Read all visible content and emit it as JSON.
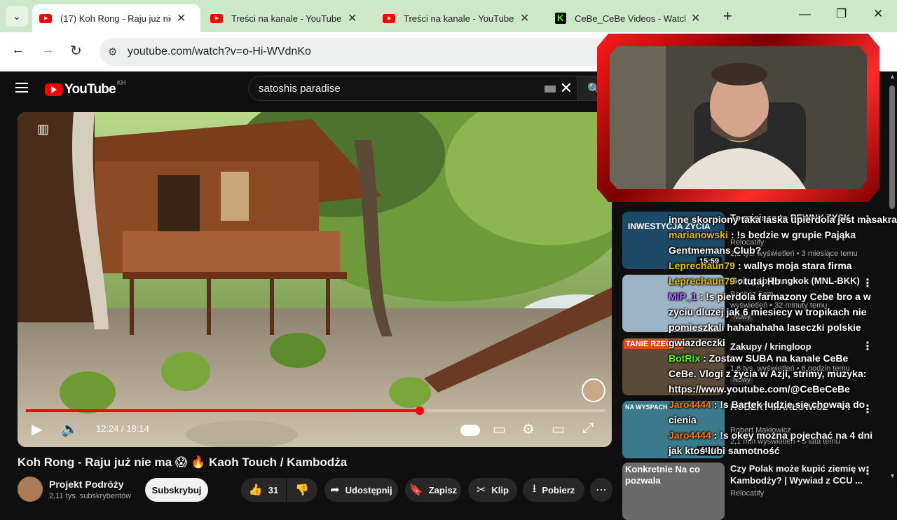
{
  "browser": {
    "tabs": [
      {
        "title": "(17) Koh Rong - Raju już nie ma",
        "icon": "youtube-icon",
        "active": true
      },
      {
        "title": "Treści na kanale - YouTube Studio",
        "icon": "youtube-icon",
        "active": false
      },
      {
        "title": "Treści na kanale - YouTube Studio",
        "icon": "youtube-icon",
        "active": false
      },
      {
        "title": "CeBe_CeBe Videos - Watch CeBe",
        "icon": "kick-icon",
        "active": false
      }
    ],
    "url": "youtube.com/watch?v=o-Hi-WVdnKo"
  },
  "youtube": {
    "logo_text": "YouTube",
    "country_code": "KH",
    "search_query": "satoshis paradise",
    "player": {
      "time_current": "12:24",
      "time_total": "18:14",
      "progress_fraction": 0.68
    },
    "video": {
      "title": "Koh Rong - Raju już nie ma 😱 🔥 Kaoh Touch / Kambodża",
      "channel": "Projekt Podróży",
      "subscribers": "2,11 tys. subskrybentów",
      "subscribe_label": "Subskrybuj",
      "likes": "31",
      "share_label": "Udostępnij",
      "save_label": "Zapisz",
      "clip_label": "Klip",
      "download_label": "Pobierz"
    },
    "recommendations": [
      {
        "title": "To miejsce to PEWNY ZYSK",
        "channel": "Relocatify",
        "meta": "2,2 tys. wyświetleń • 3 miesiące temu",
        "duration": "15:59",
        "thumb_text": "INWESTYCJA ŻYCIA"
      },
      {
        "title": "Going to Bangkok (MNL-BKK)",
        "channel": "Benitez Fam",
        "meta": "wyświetleń • 32 minuty temu",
        "badge": "Nowy",
        "duration": ""
      },
      {
        "title": "Zakupy / kringloop",
        "channel": "",
        "meta": "1,6 tys. wyświetleń • 6 godzin temu",
        "badge": "Nowy",
        "duration": "",
        "thumb_text": "TANIE RZECZY"
      },
      {
        "title": "ROBERT MAKŁOWICZ",
        "channel": "Robert Makłowicz",
        "meta": "2,1 mln wyświetleń • 3 lata temu",
        "duration": "44:19",
        "thumb_text": "NA WYSPACH"
      },
      {
        "title": "Czy Polak może kupić ziemię w Kambodży? | Wywiad z CCU ...",
        "channel": "Relocatify",
        "meta": "",
        "duration": "",
        "thumb_text": "Konkretnie Na co pozwala"
      }
    ]
  },
  "chat": [
    {
      "user": "",
      "text": "inne skorpiony taka laska upierdola jest masakra",
      "color": "#ffffff"
    },
    {
      "user": "marianowski",
      "text": ": !s bedzie w grupie Pająka",
      "color": "#e6c200"
    },
    {
      "user": "",
      "text": "Gentmemans Club?",
      "color": "#ffffff"
    },
    {
      "user": "Leprechaun79",
      "text": ": wallys moja stara firma",
      "color": "#e6c200"
    },
    {
      "user": "Leprechaun79",
      "text": ": tutaj Hb",
      "color": "#e6c200"
    },
    {
      "user": "MIP_1",
      "text": ": !s pierdola farmazony Cebe bro a w",
      "color": "#b070ff"
    },
    {
      "user": "",
      "text": "zyciu dluzej jak 6 miesiecy w tropikach nie",
      "color": "#ffffff"
    },
    {
      "user": "",
      "text": "pomieszkali hahahahaha laseczki polskie",
      "color": "#ffffff"
    },
    {
      "user": "",
      "text": "gwiazdeczki",
      "color": "#ffffff"
    },
    {
      "user": "BotRix",
      "text": ": Zostaw SUBA na kanale CeBe",
      "color": "#53fc18"
    },
    {
      "user": "",
      "text": "CeBe. Vlogi z życia w Azji, strimy, muzyka:",
      "color": "#ffffff"
    },
    {
      "user": "",
      "text": "https://www.youtube.com/@CeBeCeBe",
      "color": "#ffffff"
    },
    {
      "user": "Jaro4444",
      "text": ": !s Bartek ludzie się chowają do",
      "color": "#ff7a00"
    },
    {
      "user": "",
      "text": "cienia",
      "color": "#ffffff"
    },
    {
      "user": "Jaro4444",
      "text": ": !s okey można pojechać na 4 dni",
      "color": "#ff7a00"
    },
    {
      "user": "",
      "text": "jak ktoś lubi samotność",
      "color": "#ffffff"
    }
  ],
  "colors": {
    "accent": "#ff0000",
    "cam_frame": "#e01010",
    "kick_green": "#53fc18"
  }
}
